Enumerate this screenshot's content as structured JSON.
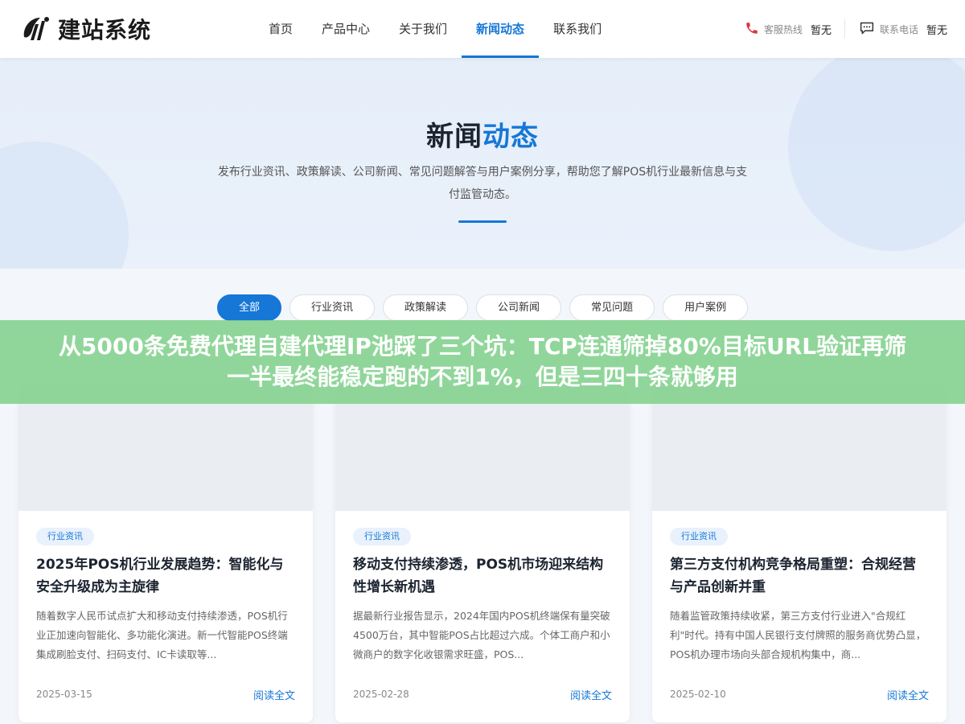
{
  "header": {
    "logo_text": "建站系统",
    "nav": [
      {
        "label": "首页"
      },
      {
        "label": "产品中心"
      },
      {
        "label": "关于我们"
      },
      {
        "label": "新闻动态"
      },
      {
        "label": "联系我们"
      }
    ],
    "active_nav": "新闻动态",
    "hotline_label": "客服热线",
    "hotline_value": "暂无",
    "phone_label": "联系电话",
    "phone_value": "暂无"
  },
  "hero": {
    "title_prefix": "新闻",
    "title_accent": "动态",
    "description": "发布行业资讯、政策解读、公司新闻、常见问题解答与用户案例分享，帮助您了解POS机行业最新信息与支付监管动态。"
  },
  "tabs": [
    {
      "label": "全部"
    },
    {
      "label": "行业资讯"
    },
    {
      "label": "政策解读"
    },
    {
      "label": "公司新闻"
    },
    {
      "label": "常见问题"
    },
    {
      "label": "用户案例"
    }
  ],
  "active_tab": "全部",
  "overlay": {
    "text": "从5000条免费代理自建代理IP池踩了三个坑：TCP连通筛掉80%目标URL验证再筛一半最终能稳定跑的不到1%，但是三四十条就够用"
  },
  "cards": [
    {
      "tag": "行业资讯",
      "title": "2025年POS机行业发展趋势：智能化与安全升级成为主旋律",
      "text": "随着数字人民币试点扩大和移动支付持续渗透，POS机行业正加速向智能化、多功能化演进。新一代智能POS终端集成刷脸支付、扫码支付、IC卡读取等...",
      "date": "2025-03-15",
      "more": "阅读全文"
    },
    {
      "tag": "行业资讯",
      "title": "移动支付持续渗透，POS机市场迎来结构性增长新机遇",
      "text": "据最新行业报告显示，2024年国内POS机终端保有量突破4500万台，其中智能POS占比超过六成。个体工商户和小微商户的数字化收银需求旺盛，POS...",
      "date": "2025-02-28",
      "more": "阅读全文"
    },
    {
      "tag": "行业资讯",
      "title": "第三方支付机构竞争格局重塑：合规经营与产品创新并重",
      "text": "随着监管政策持续收紧，第三方支付行业进入\"合规红利\"时代。持有中国人民银行支付牌照的服务商优势凸显，POS机办理市场向头部合规机构集中，商...",
      "date": "2025-02-10",
      "more": "阅读全文"
    }
  ],
  "colors": {
    "accent": "#1677d6",
    "overlay": "#82d28c"
  }
}
